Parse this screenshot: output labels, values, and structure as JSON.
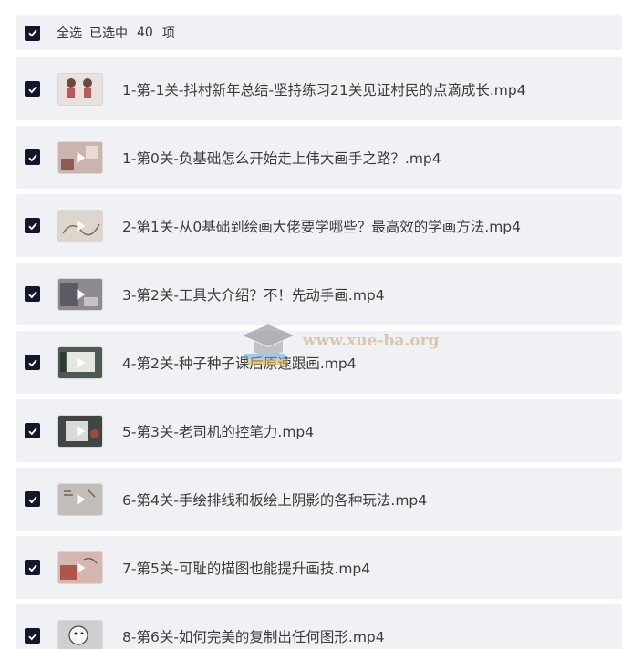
{
  "header": {
    "select_all_label": "全选",
    "selected_label": "已选中",
    "selected_count": "40",
    "items_unit": "项"
  },
  "files": [
    {
      "name": "1-第-1关-抖村新年总结-坚持练习21关见证村民的点滴成长.mp4",
      "thumb_color": "#e9e1dc"
    },
    {
      "name": "1-第0关-负基础怎么开始走上伟大画手之路？.mp4",
      "thumb_color": "#c9b5ad"
    },
    {
      "name": "2-第1关-从0基础到绘画大佬要学哪些？最高效的学画方法.mp4",
      "thumb_color": "#dcd6cd"
    },
    {
      "name": "3-第2关-工具大介绍？不！先动手画.mp4",
      "thumb_color": "#8f8a91"
    },
    {
      "name": "4-第2关-种子种子课后原速跟画.mp4",
      "thumb_color": "#4c5a52"
    },
    {
      "name": "5-第3关-老司机的控笔力.mp4",
      "thumb_color": "#3f4644"
    },
    {
      "name": "6-第4关-手绘排线和板绘上阴影的各种玩法.mp4",
      "thumb_color": "#c2bdb8"
    },
    {
      "name": "7-第5关-可耻的描图也能提升画技.mp4",
      "thumb_color": "#d6b7b0"
    },
    {
      "name": "8-第6关-如何完美的复制出任何图形.mp4",
      "thumb_color": "#cfcfcf"
    }
  ],
  "watermark": {
    "text": "www.xue-ba.org"
  },
  "colors": {
    "checkbox": "#14162b",
    "row_bg": "#f0f1f4",
    "watermark": "#c9a56a"
  }
}
